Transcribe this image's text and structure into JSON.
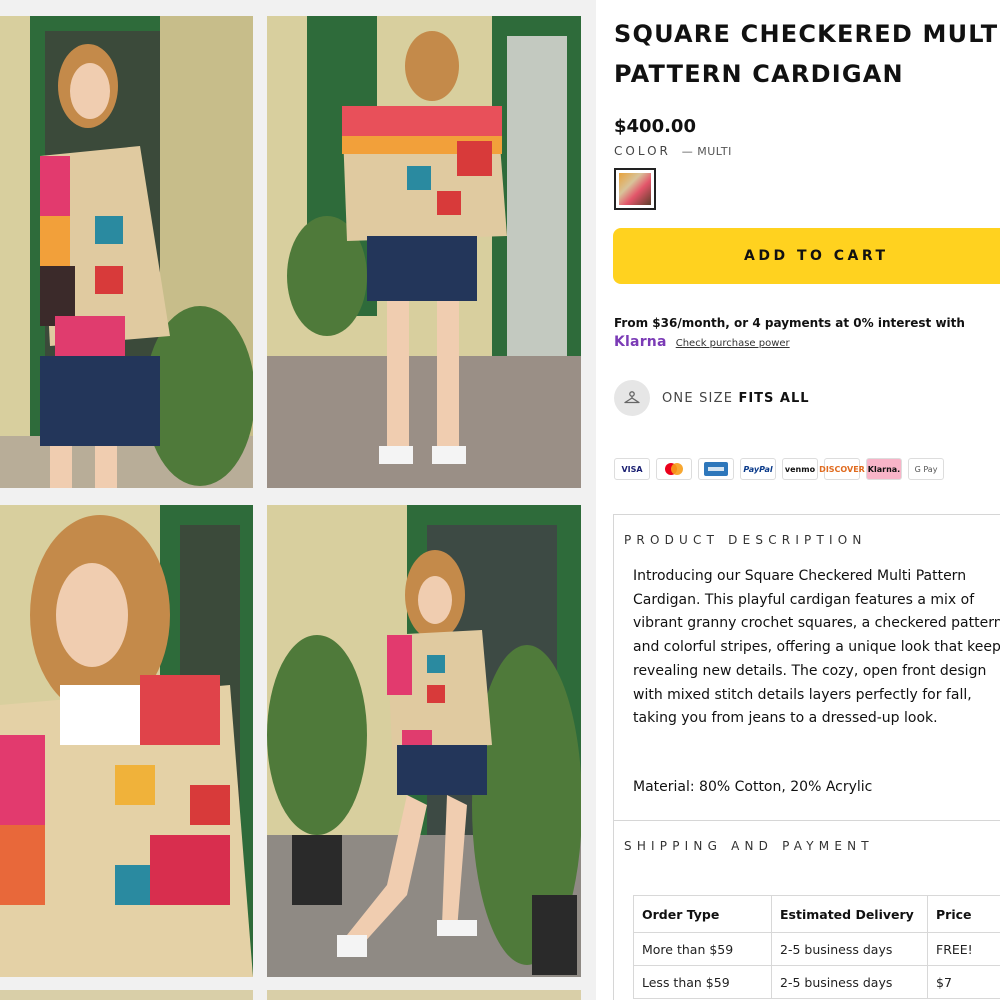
{
  "gallery": {
    "images": [
      {
        "name": "product-photo-front-side"
      },
      {
        "name": "product-photo-back"
      },
      {
        "name": "product-photo-closeup"
      },
      {
        "name": "product-photo-full-length"
      }
    ]
  },
  "product": {
    "title_line1": "SQUARE CHECKERED MULTI",
    "title_line2": "PATTERN CARDIGAN",
    "price": "$400.00",
    "color_label": "COLOR",
    "color_value": "— MULTI",
    "add_to_cart": "ADD TO CART",
    "financing_text": "From $36/month, or 4 payments at 0% interest with",
    "klarna_logo": "Klarna",
    "klarna_link": "Check purchase power",
    "size_prefix": "ONE SIZE",
    "size_value": "FITS ALL"
  },
  "payment_methods": [
    {
      "label": "VISA",
      "icon": "visa-icon"
    },
    {
      "label": "",
      "icon": "mastercard-icon"
    },
    {
      "label": "",
      "icon": "amex-icon"
    },
    {
      "label": "PayPal",
      "icon": "paypal-icon"
    },
    {
      "label": "venmo",
      "icon": "venmo-icon"
    },
    {
      "label": "DISCOVER",
      "icon": "discover-icon"
    },
    {
      "label": "Klarna.",
      "icon": "klarna-icon"
    },
    {
      "label": "G Pay",
      "icon": "google-pay-icon"
    }
  ],
  "description": {
    "heading": "PRODUCT DESCRIPTION",
    "body": "Introducing our Square Checkered Multi Pattern Cardigan. This playful cardigan features a mix of vibrant granny crochet squares, a checkered pattern, and colorful stripes, offering a unique look that keeps revealing new details. The cozy, open front design with mixed stitch details layers perfectly for fall, taking you from jeans to a dressed-up look.",
    "material": "Material: 80% Cotton, 20% Acrylic"
  },
  "shipping": {
    "heading": "SHIPPING AND PAYMENT",
    "columns": [
      "Order Type",
      "Estimated Delivery",
      "Price"
    ],
    "rows": [
      [
        "More than $59",
        "2-5 business days",
        "FREE!"
      ],
      [
        "Less than $59",
        "2-5 business days",
        "$7"
      ]
    ]
  },
  "colors": {
    "accent_yellow": "#ffd21f",
    "klarna_purple": "#7b3bb6",
    "door_green": "#2e6b3a",
    "wall_yellow": "#d8cf9e"
  }
}
